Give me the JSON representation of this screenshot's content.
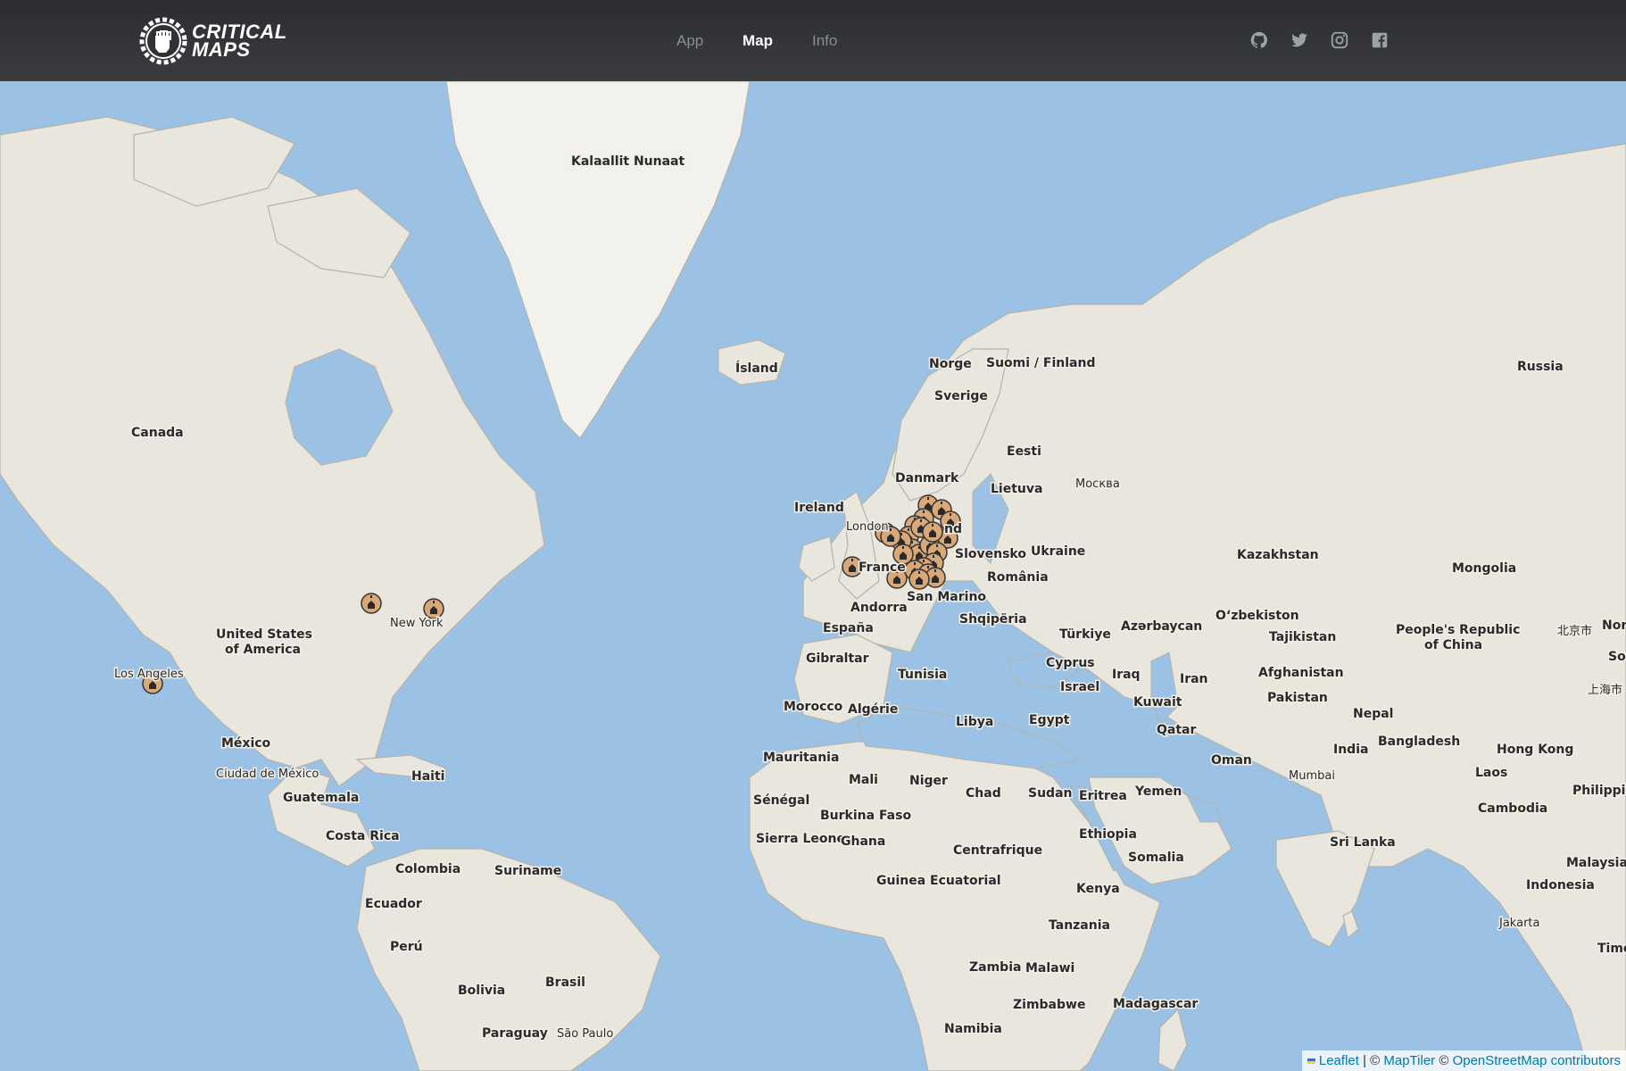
{
  "brand": {
    "line1": "CRITICAL",
    "line2": "MAPS"
  },
  "nav": {
    "app": "App",
    "map": "Map",
    "info": "Info"
  },
  "social": [
    "github-icon",
    "twitter-icon",
    "instagram-icon",
    "facebook-icon"
  ],
  "colors": {
    "water": "#9bc2e4",
    "land": "#e8e6dd",
    "greenland": "#f2f1ec",
    "marker": "#d9a878",
    "header": "#2f3134"
  },
  "labels": {
    "greenland": "Kalaallit Nunaat",
    "iceland": "Ísland",
    "canada": "Canada",
    "usa1": "United States",
    "usa2": "of America",
    "mexico": "México",
    "mexico_city": "Ciudad de México",
    "los_angeles": "Los Angeles",
    "new_york": "New York",
    "haiti": "Haiti",
    "guatemala": "Guatemala",
    "costa_rica": "Costa Rica",
    "colombia": "Colombia",
    "suriname": "Suriname",
    "ecuador": "Ecuador",
    "peru": "Perú",
    "brasil": "Brasil",
    "bolivia": "Bolivia",
    "paraguay": "Paraguay",
    "sao_paulo": "São Paulo",
    "ireland": "Ireland",
    "london": "London",
    "france": "France",
    "espana": "España",
    "andorra": "Andorra",
    "gibraltar": "Gibraltar",
    "san_marino": "San Marino",
    "norge": "Norge",
    "sverige": "Sverige",
    "suomi": "Suomi / Finland",
    "danmark": "Danmark",
    "eesti": "Eesti",
    "lietuva": "Lietuva",
    "moskva": "Москва",
    "polska_end": "nd",
    "slovensko": "Slovensko",
    "ukraine": "Ukraine",
    "romania": "România",
    "shqiperia": "Shqipëria",
    "turkiye": "Türkiye",
    "azerbaycan": "Azərbaycan",
    "cyprus": "Cyprus",
    "israel": "Israel",
    "iraq": "Iraq",
    "iran": "Iran",
    "kuwait": "Kuwait",
    "qatar": "Qatar",
    "oman": "Oman",
    "yemen": "Yemen",
    "russia": "Russia",
    "kazakhstan": "Kazakhstan",
    "mongolia": "Mongolia",
    "uzbekistan": "O‘zbekiston",
    "tajikistan": "Tajikistan",
    "afghanistan": "Afghanistan",
    "pakistan": "Pakistan",
    "nepal": "Nepal",
    "india": "India",
    "mumbai": "Mumbai",
    "bangladesh": "Bangladesh",
    "china1": "People's Republic",
    "china2": "of China",
    "beijing": "北京市",
    "shanghai": "上海市",
    "hong_kong": "Hong Kong",
    "laos": "Laos",
    "cambodia": "Cambodia",
    "philippines": "Philippin",
    "malaysia": "Malaysia",
    "indonesia": "Indonesia",
    "jakarta": "Jakarta",
    "timor": "Timo",
    "sri_lanka": "Sri Lanka",
    "nor": "Nor",
    "sou": "Sou",
    "tunisia": "Tunisia",
    "morocco": "Morocco",
    "algerie": "Algérie",
    "libya": "Libya",
    "egypt": "Egypt",
    "mauritania": "Mauritania",
    "mali": "Mali",
    "niger": "Niger",
    "chad": "Chad",
    "sudan": "Sudan",
    "eritrea": "Eritrea",
    "senegal": "Sénégal",
    "burkina": "Burkina Faso",
    "sierra_leone": "Sierra Leone",
    "ghana": "Ghana",
    "centrafrique": "Centrafrique",
    "ethiopia": "Ethiopia",
    "somalia": "Somalia",
    "guinea_eq": "Guinea Ecuatorial",
    "kenya": "Kenya",
    "tanzania": "Tanzania",
    "zambia": "Zambia",
    "malawi": "Malawi",
    "zimbabwe": "Zimbabwe",
    "madagascar": "Madagascar",
    "namibia": "Namibia"
  },
  "attribution": {
    "leaflet": "Leaflet",
    "sep": " | © ",
    "maptiler": "MapTiler",
    "copy": " © ",
    "osm": "OpenStreetMap contributors"
  }
}
